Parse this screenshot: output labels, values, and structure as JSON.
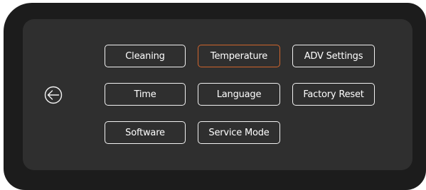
{
  "menu": {
    "back_icon": "arrow-left-circle-icon",
    "active_color": "#d0652d",
    "items": {
      "cleaning": "Cleaning",
      "temperature": "Temperature",
      "adv_settings": "ADV Settings",
      "time": "Time",
      "language": "Language",
      "factory_reset": "Factory Reset",
      "software": "Software",
      "service_mode": "Service Mode"
    },
    "selected": "Temperature"
  }
}
